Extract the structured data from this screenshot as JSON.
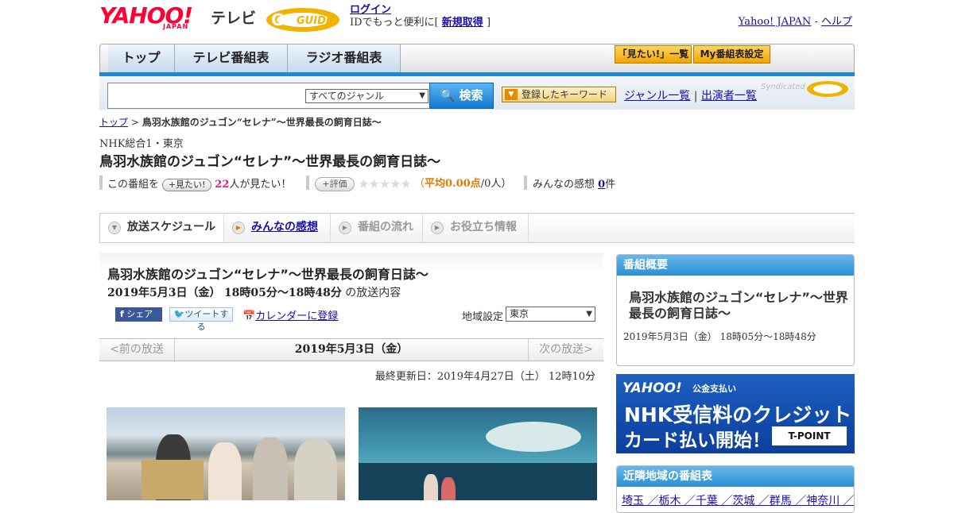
{
  "header": {
    "yahoo_logo": "YAHOO!",
    "japan_text": "JAPAN",
    "tv_text": "テレビ",
    "gguide_logo": "G GUIDE",
    "login": "ログイン",
    "login_sub_prefix": "IDでもっと便利に[",
    "register": "新規取得",
    "login_sub_suffix": "]",
    "yahoo_japan_link": "Yahoo! JAPAN",
    "link_sep": "-",
    "help_link": "ヘルプ"
  },
  "nav": {
    "tabs": [
      "トップ",
      "テレビ番組表",
      "ラジオ番組表"
    ],
    "mitai_list": "「見たい!」一覧",
    "my_settings": "My番組表設定"
  },
  "search": {
    "genre_value": "すべてのジャンル",
    "button": "検索",
    "keyword_button": "登録したキーワード",
    "genre_list": "ジャンル一覧",
    "divider": "|",
    "performer_list": "出演者一覧",
    "syndicated": "Syndicated"
  },
  "breadcrumb": {
    "top": "トップ",
    "sep": ">",
    "current": "鳥羽水族館のジュゴン“セレナ”～世界最長の飼育日誌～"
  },
  "program": {
    "channel": "NHK総合1・東京",
    "title": "鳥羽水族館のジュゴン“セレナ”～世界最長の飼育日誌～",
    "this_program": "この番組を",
    "mitai_btn": "見たい!",
    "mitai_count": "22",
    "mitai_suffix": "人が見たい！",
    "hyoka_btn": "評価",
    "stars": "★★★★★",
    "avg_open": "（",
    "avg_label": "平均0.00点",
    "avg_people": "/0人）",
    "kansou_label": "みんなの感想",
    "kansou_count": "0",
    "kansou_suffix": "件"
  },
  "tabs": {
    "schedule": "放送スケジュール",
    "kansou": "みんなの感想",
    "flow": "番組の流れ",
    "info": "お役立ち情報"
  },
  "main": {
    "title": "鳥羽水族館のジュゴン“セレナ”～世界最長の飼育日誌～",
    "air_date": "2019年5月3日（金）",
    "air_time": "18時05分～18時48分",
    "air_suffix": "の放送内容",
    "share": "シェア",
    "tweet": "ツイートする",
    "calendar": "カレンダーに登録",
    "region_label": "地域設定",
    "region_value": "東京",
    "prev": "<前の放送",
    "current_date": "2019年5月3日（金）",
    "next": "次の放送>",
    "updated": "最終更新日：2019年4月27日（土） 12時10分"
  },
  "sidebar": {
    "summary_header": "番組概要",
    "summary_title": "鳥羽水族館のジュゴン“セレナ”～世界最長の飼育日誌～",
    "summary_datetime": "2019年5月3日（金） 18時05分～18時48分",
    "ad_logo": "YAHOO!",
    "ad_koukin": "公金支払い",
    "ad_line1": "NHK受信料のクレジット",
    "ad_line2": "カード払い開始！",
    "ad_tpoint": "T-POINT",
    "neighbor_header": "近隣地域の番組表",
    "neighbor_links": "埼玉 ／栃木 ／千葉 ／茨城 ／群馬 ／神奈川 ／東"
  },
  "colors": {
    "brand_red": "#ff0033",
    "accent_blue": "#1e88d3",
    "gguide_yellow": "#f0b400"
  }
}
